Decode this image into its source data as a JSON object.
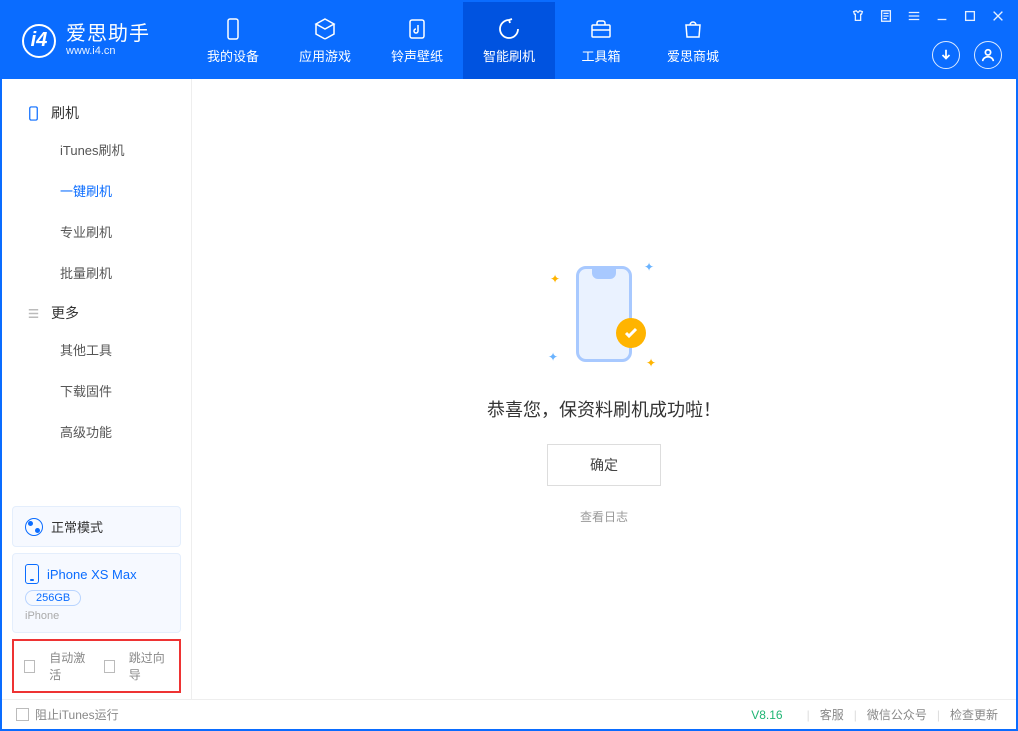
{
  "app": {
    "name_cn": "爱思助手",
    "name_en": "www.i4.cn"
  },
  "nav": {
    "device": "我的设备",
    "apps": "应用游戏",
    "ring": "铃声壁纸",
    "flash": "智能刷机",
    "toolbox": "工具箱",
    "store": "爱思商城"
  },
  "sidebar": {
    "group_flash": "刷机",
    "items_flash": {
      "itunes": "iTunes刷机",
      "onekey": "一键刷机",
      "pro": "专业刷机",
      "batch": "批量刷机"
    },
    "group_more": "更多",
    "items_more": {
      "other": "其他工具",
      "firmware": "下载固件",
      "advanced": "高级功能"
    }
  },
  "device": {
    "mode": "正常模式",
    "name": "iPhone XS Max",
    "capacity": "256GB",
    "type": "iPhone"
  },
  "options": {
    "auto_activate": "自动激活",
    "skip_guide": "跳过向导"
  },
  "main": {
    "success": "恭喜您，保资料刷机成功啦！",
    "ok": "确定",
    "view_log": "查看日志"
  },
  "footer": {
    "block_itunes": "阻止iTunes运行",
    "version": "V8.16",
    "service": "客服",
    "wechat": "微信公众号",
    "update": "检查更新"
  }
}
